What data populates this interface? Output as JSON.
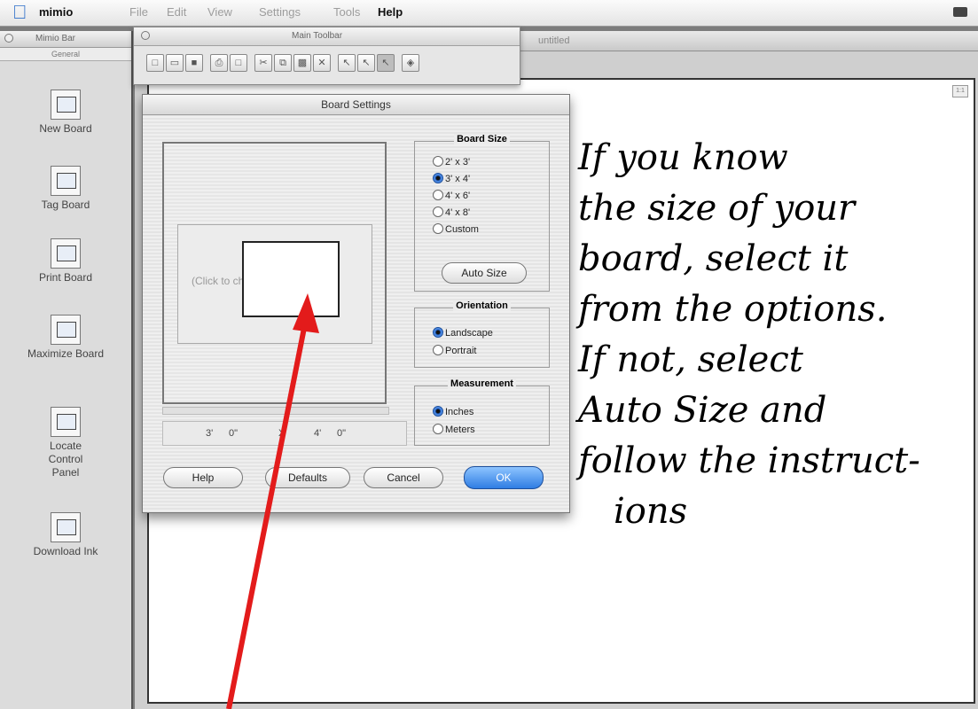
{
  "menubar": {
    "app": "mimio",
    "items": [
      "File",
      "Edit",
      "View",
      "Settings",
      "Tools"
    ],
    "help": "Help"
  },
  "mimio_bar": {
    "title": "Mimio Bar",
    "section": "General",
    "items": [
      {
        "label": "New Board",
        "icon": "new-board-icon"
      },
      {
        "label": "Tag Board",
        "icon": "tag-board-icon"
      },
      {
        "label": "Print Board",
        "icon": "print-board-icon"
      },
      {
        "label": "Maximize Board",
        "icon": "maximize-board-icon"
      },
      {
        "label": "Locate Control Panel",
        "icon": "locate-control-panel-icon"
      },
      {
        "label": "Download Ink",
        "icon": "download-ink-icon"
      }
    ]
  },
  "main_window": {
    "title": "untitled"
  },
  "main_toolbar": {
    "title": "Main Toolbar"
  },
  "dialog": {
    "title": "Board Settings",
    "preview_hint": "(Click to change color)",
    "dims": {
      "width_ft": "3'",
      "width_in": "0\"",
      "sep": "X",
      "height_ft": "4'",
      "height_in": "0\""
    },
    "board_size": {
      "title": "Board Size",
      "options": [
        "2' x 3'",
        "3' x 4'",
        "4' x 6'",
        "4' x 8'",
        "Custom"
      ],
      "selected_index": 1,
      "auto_size": "Auto Size"
    },
    "orientation": {
      "title": "Orientation",
      "options": [
        "Landscape",
        "Portrait"
      ],
      "selected_index": 0
    },
    "measurement": {
      "title": "Measurement",
      "options": [
        "Inches",
        "Meters"
      ],
      "selected_index": 0
    },
    "buttons": {
      "help": "Help",
      "defaults": "Defaults",
      "cancel": "Cancel",
      "ok": "OK"
    }
  },
  "note": {
    "lines": [
      "If you know",
      "the size of your",
      "board, select it",
      "from the options.",
      "If not, select",
      "Auto Size and",
      "follow the instruct-",
      "ions"
    ]
  },
  "colors": {
    "arrow": "#e31b1b",
    "ok_button": "#2f7de3",
    "selected_radio": "#2c6fd6"
  }
}
